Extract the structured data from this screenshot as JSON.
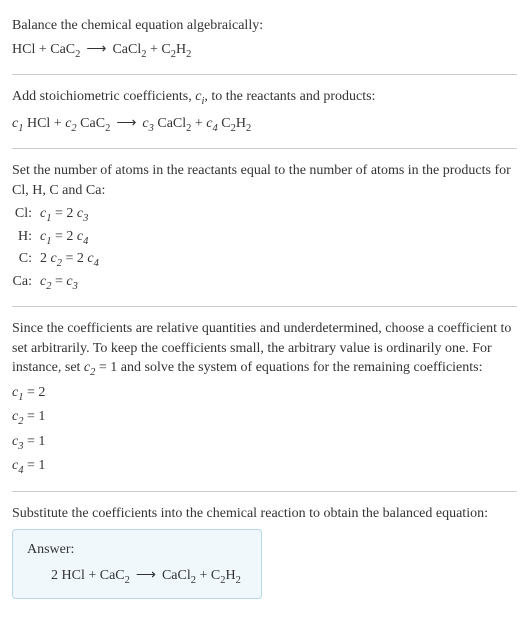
{
  "chart_data": {
    "type": "table",
    "title": "Balance the chemical equation algebraically: HCl + CaC2 → CaCl2 + C2H2",
    "reactants": [
      "HCl",
      "CaC2"
    ],
    "products": [
      "CaCl2",
      "C2H2"
    ],
    "unknown_coefficients": [
      "c1",
      "c2",
      "c3",
      "c4"
    ],
    "atom_balance": [
      {
        "element": "Cl",
        "lhs": "c1",
        "rhs": "2 c3"
      },
      {
        "element": "H",
        "lhs": "c1",
        "rhs": "2 c4"
      },
      {
        "element": "C",
        "lhs": "2 c2",
        "rhs": "2 c4"
      },
      {
        "element": "Ca",
        "lhs": "c2",
        "rhs": "c3"
      }
    ],
    "arbitrary_set": "c2 = 1",
    "solution": {
      "c1": 2,
      "c2": 1,
      "c3": 1,
      "c4": 1
    },
    "balanced_equation": "2 HCl + CaC2 → CaCl2 + C2H2"
  },
  "section1": {
    "title": "Balance the chemical equation algebraically:"
  },
  "section2": {
    "title_a": "Add stoichiometric coefficients, ",
    "title_b": ", to the reactants and products:"
  },
  "section3": {
    "title": "Set the number of atoms in the reactants equal to the number of atoms in the products for Cl, H, C and Ca:",
    "rows": [
      {
        "label": "Cl:"
      },
      {
        "label": "H:"
      },
      {
        "label": "C:"
      },
      {
        "label": "Ca:"
      }
    ]
  },
  "section4": {
    "title_a": "Since the coefficients are relative quantities and underdetermined, choose a coefficient to set arbitrarily. To keep the coefficients small, the arbitrary value is ordinarily one. For instance, set ",
    "title_b": " = 1 and solve the system of equations for the remaining coefficients:"
  },
  "section5": {
    "title": "Substitute the coefficients into the chemical reaction to obtain the balanced equation:"
  },
  "answer": {
    "label": "Answer:"
  }
}
